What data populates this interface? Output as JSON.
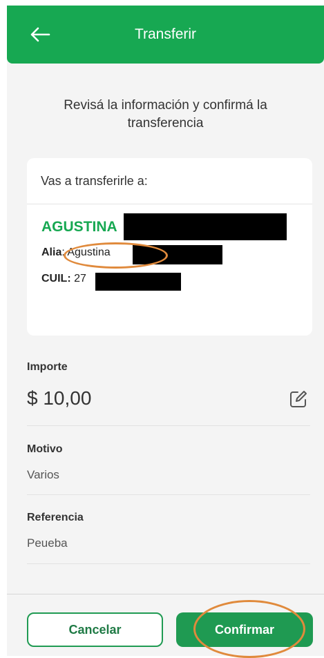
{
  "header": {
    "title": "Transferir",
    "back_icon": "arrow-left-icon"
  },
  "subtitle": "Revisá la información y confirmá la transferencia",
  "recipient_card": {
    "heading": "Vas a transferirle a:",
    "name": "AGUSTINA",
    "alias_label": "Alia",
    "alias_value": ": Agustina",
    "cuil_label": "CUIL:",
    "cuil_value": "27"
  },
  "amount": {
    "label": "Importe",
    "value": "$ 10,00",
    "edit_icon": "edit-icon"
  },
  "motivo": {
    "label": "Motivo",
    "value": "Varios"
  },
  "referencia": {
    "label": "Referencia",
    "value": "Peueba"
  },
  "buttons": {
    "cancel": "Cancelar",
    "confirm": "Confirmar"
  },
  "colors": {
    "brand": "#17a852",
    "annotation": "#e08a3c",
    "redaction": "#000000"
  }
}
